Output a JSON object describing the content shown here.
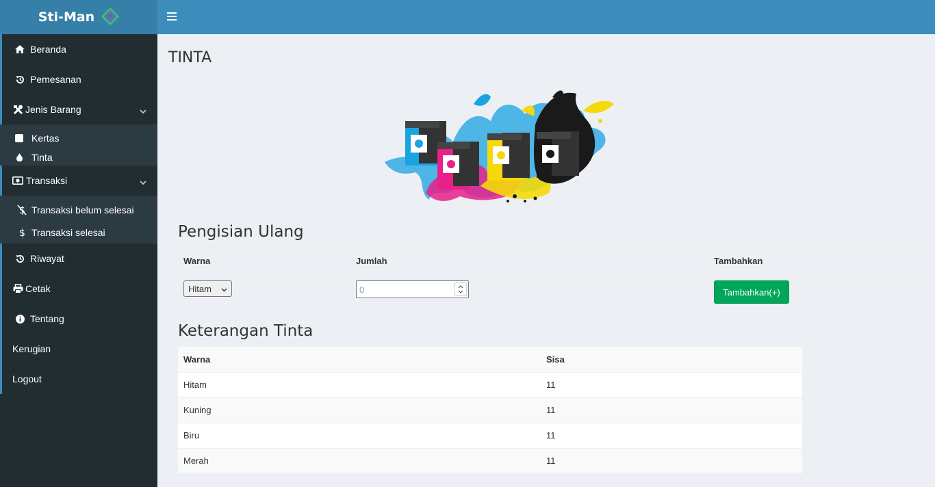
{
  "app": {
    "name": "Sti-Man"
  },
  "sidebar": {
    "items": [
      {
        "label": "Beranda"
      },
      {
        "label": "Pemesanan"
      },
      {
        "label": "Jenis Barang"
      },
      {
        "label": "Transaksi"
      },
      {
        "label": "Riwayat"
      },
      {
        "label": "Cetak"
      },
      {
        "label": "Tentang"
      },
      {
        "label": "Kerugian"
      },
      {
        "label": "Logout"
      }
    ],
    "jenis_barang_sub": [
      {
        "label": "Kertas"
      },
      {
        "label": "Tinta"
      }
    ],
    "transaksi_sub": [
      {
        "label": "Transaksi belum selesai"
      },
      {
        "label": "Transaksi selesai"
      }
    ]
  },
  "page": {
    "title": "TINTA"
  },
  "refill": {
    "title": "Pengisian Ulang",
    "headers": {
      "warna": "Warna",
      "jumlah": "Jumlah",
      "tambahkan": "Tambahkan"
    },
    "color_selected": "Hitam",
    "quantity_placeholder": "0",
    "button_label": "Tambahkan(+)"
  },
  "info": {
    "title": "Keterangan Tinta",
    "headers": {
      "warna": "Warna",
      "sisa": "Sisa"
    },
    "rows": [
      {
        "warna": "Hitam",
        "sisa": "11"
      },
      {
        "warna": "Kuning",
        "sisa": "11"
      },
      {
        "warna": "Biru",
        "sisa": "11"
      },
      {
        "warna": "Merah",
        "sisa": "11"
      }
    ]
  },
  "colors": {
    "header": "#3c8dbc",
    "logo_bg": "#367fa9",
    "sidebar": "#222d32",
    "submenu": "#2c3b41",
    "button_green": "#00a65a",
    "ink_cyan": "#1aa3e0",
    "ink_magenta": "#e8208a",
    "ink_yellow": "#f5d90a",
    "ink_black": "#1a1a1a"
  },
  "icons": {
    "logo": "diamond-logo-icon",
    "menu": "hamburger-icon",
    "beranda": "home-icon",
    "pemesanan": "history-icon",
    "jenis_barang": "tools-icon",
    "kertas": "square-icon",
    "tinta": "tint-icon",
    "transaksi": "money-icon",
    "belum_selesai": "dollar-slash-icon",
    "selesai": "dollar-icon",
    "riwayat": "history-icon",
    "cetak": "print-icon",
    "tentang": "info-icon",
    "expand": "chevron-down-icon"
  }
}
